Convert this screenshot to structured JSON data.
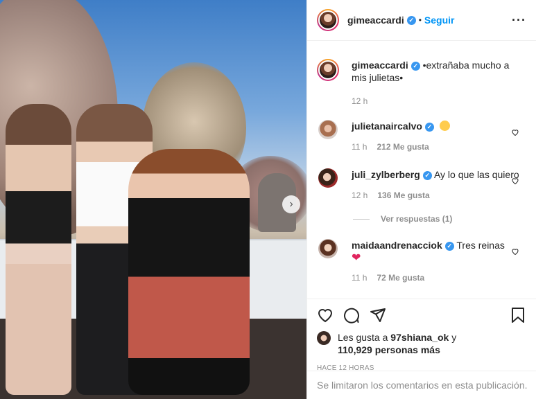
{
  "post": {
    "author": "gimeaccardi",
    "follow_label": "Seguir",
    "follow_separator": "•",
    "caption": "•extrañaba mucho a mis julietas•",
    "caption_time": "12 h",
    "likes_prefix": "Les gusta a ",
    "likes_user": "97shiana_ok",
    "likes_mid": " y",
    "likes_count_line": "110,929 personas más",
    "posted_ago": "HACE 12 HORAS",
    "comments_closed": "Se limitaron los comentarios en esta publicación."
  },
  "comments": [
    {
      "user": "julietanaircalvo",
      "text": "",
      "emoji": "heart-eyes-emoji",
      "time": "11 h",
      "likes": "212 Me gusta"
    },
    {
      "user": "juli_zylberberg",
      "text": "Ay lo que las quiero",
      "time": "12 h",
      "likes": "136 Me gusta",
      "replies": "Ver respuestas (1)"
    },
    {
      "user": "maidaandrenacciok",
      "text": "Tres reinas",
      "emoji": "red-heart-emoji",
      "time": "11 h",
      "likes": "72 Me gusta"
    }
  ],
  "icons": [
    "verified-icon",
    "more-options-icon",
    "like-icon",
    "comment-icon",
    "share-icon",
    "save-icon",
    "next-image-icon"
  ],
  "colors": {
    "accent": "#0095f6",
    "verified": "#3897f0",
    "muted": "#8e8e8e",
    "text": "#262626"
  }
}
